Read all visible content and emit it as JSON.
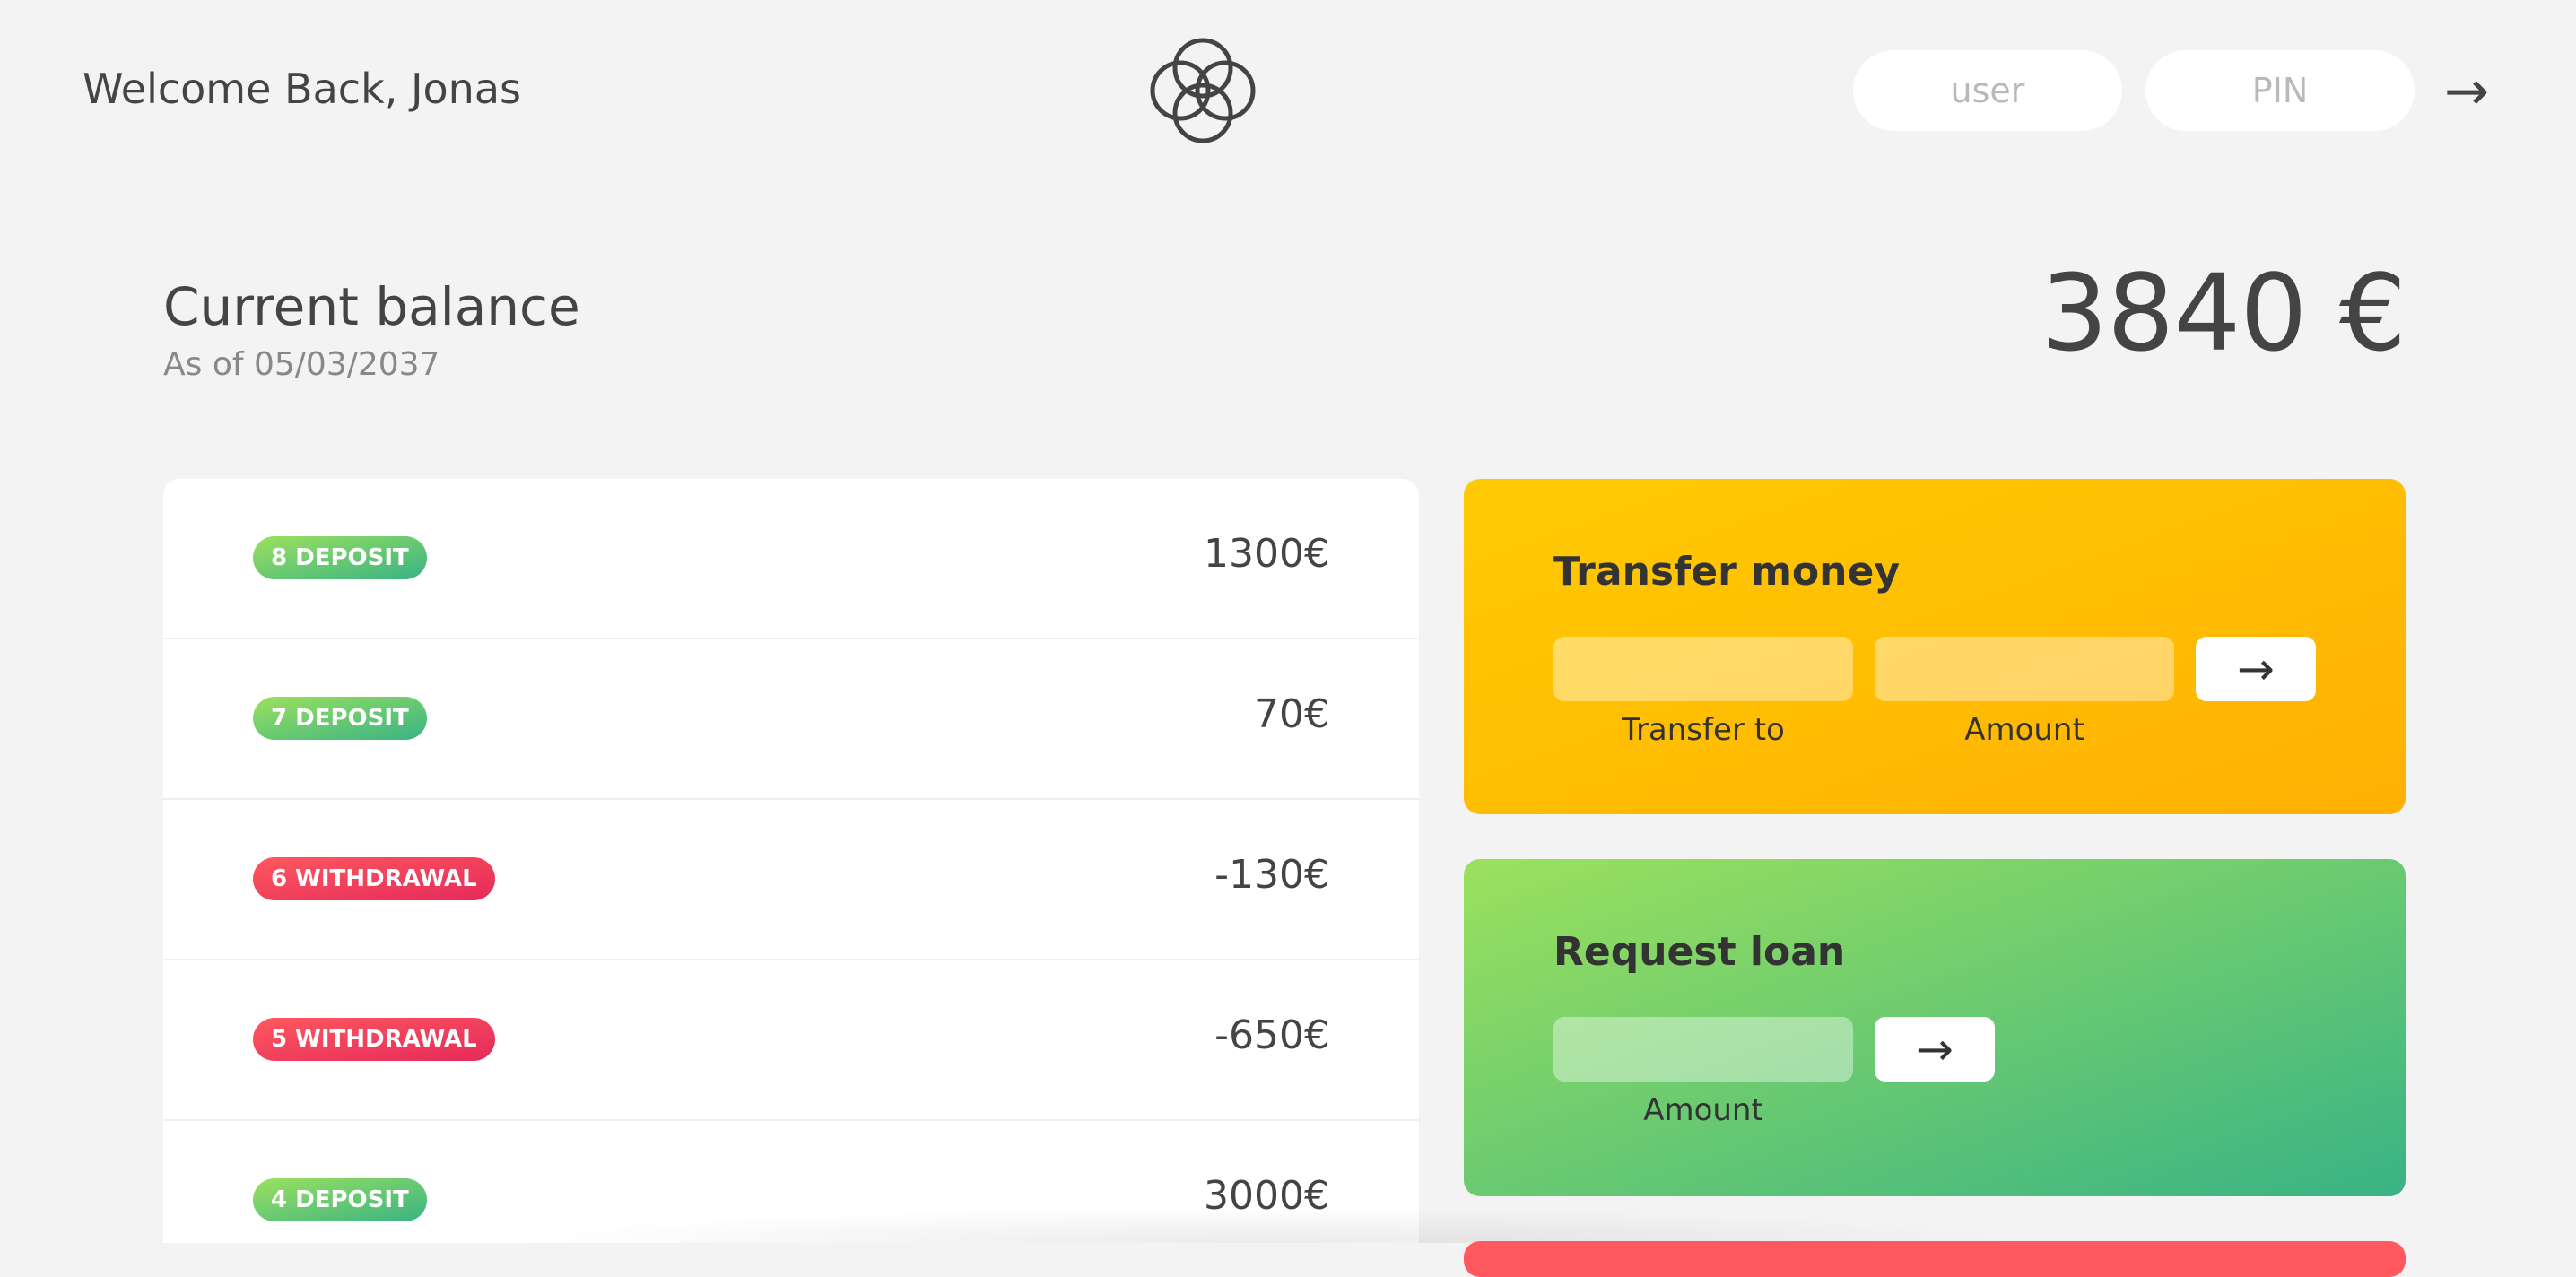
{
  "nav": {
    "welcome": "Welcome Back, Jonas",
    "login": {
      "user_placeholder": "user",
      "pin_placeholder": "PIN",
      "submit_label": "→"
    }
  },
  "balance": {
    "label": "Current balance",
    "date": "As of 05/03/2037",
    "value": "3840 €"
  },
  "movements": [
    {
      "type": "8 deposit",
      "value": "1300€"
    },
    {
      "type": "7 deposit",
      "value": "70€"
    },
    {
      "type": "6 withdrawal",
      "value": "-130€"
    },
    {
      "type": "5 withdrawal",
      "value": "-650€"
    },
    {
      "type": "4 deposit",
      "value": "3000€"
    }
  ],
  "operations": {
    "transfer": {
      "title": "Transfer money",
      "to_label": "Transfer to",
      "amount_label": "Amount",
      "submit_label": "→"
    },
    "loan": {
      "title": "Request loan",
      "amount_label": "Amount",
      "submit_label": "→"
    }
  },
  "colors": {
    "background": "#f3f3f3",
    "deposit": "#39b385",
    "withdrawal": "#e52a5a",
    "transfer": "#ffb003",
    "loan": "#9be15d",
    "close": "#ff585f"
  }
}
